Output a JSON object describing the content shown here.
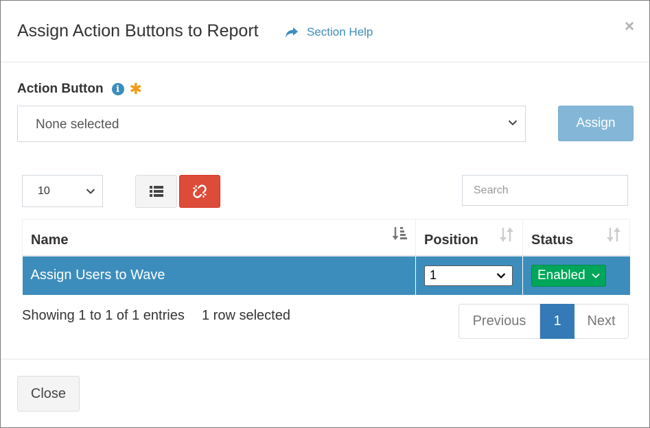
{
  "modal": {
    "title": "Assign Action Buttons to Report",
    "section_help": "Section Help"
  },
  "action_button": {
    "label": "Action Button",
    "selected": "None selected",
    "assign_label": "Assign"
  },
  "table_controls": {
    "page_length": "10",
    "search_placeholder": "Search"
  },
  "table": {
    "columns": [
      "Name",
      "Position",
      "Status"
    ],
    "rows": [
      {
        "name": "Assign Users to Wave",
        "position": "1",
        "status": "Enabled"
      }
    ]
  },
  "footer_info": {
    "showing": "Showing 1 to 1 of 1 entries",
    "selected": "1 row selected"
  },
  "pagination": {
    "previous": "Previous",
    "current": "1",
    "next": "Next"
  },
  "close_label": "Close",
  "colors": {
    "primary": "#3c8dbc",
    "danger": "#dd4b39",
    "success": "#00a65a",
    "required": "#f39c12"
  },
  "icons": {
    "help": "share-arrow-icon",
    "info": "info-circle-icon",
    "required": "asterisk-icon",
    "list": "list-icon",
    "unlink": "unlink-icon"
  }
}
